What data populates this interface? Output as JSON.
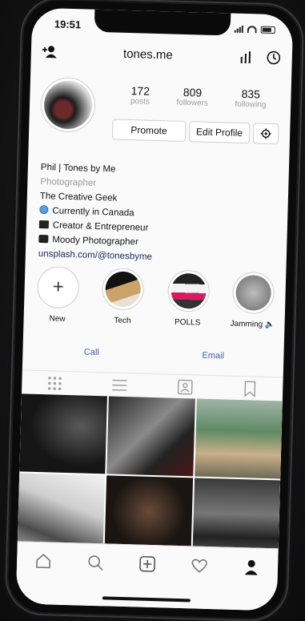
{
  "status": {
    "time": "19:51"
  },
  "header": {
    "username": "tones.me"
  },
  "profile": {
    "stats": [
      {
        "count": "172",
        "label": "posts"
      },
      {
        "count": "809",
        "label": "followers"
      },
      {
        "count": "835",
        "label": "following"
      }
    ],
    "promote_label": "Promote",
    "edit_label": "Edit Profile"
  },
  "bio": {
    "name": "Phil | Tones by Me",
    "category": "Photographer",
    "lines": [
      "The Creative Geek",
      "Currently in Canada",
      "Creator & Entrepreneur",
      "Moody Photographer"
    ],
    "link": "unsplash.com/@tonesbyme"
  },
  "highlights": [
    {
      "label": "New"
    },
    {
      "label": "Tech"
    },
    {
      "label": "POLLS"
    },
    {
      "label": "Jamming 🔈"
    }
  ],
  "contacts": {
    "call": "Call",
    "email": "Email"
  },
  "colors": {
    "link": "#3a5ea8",
    "muted": "#9a9a9a"
  }
}
